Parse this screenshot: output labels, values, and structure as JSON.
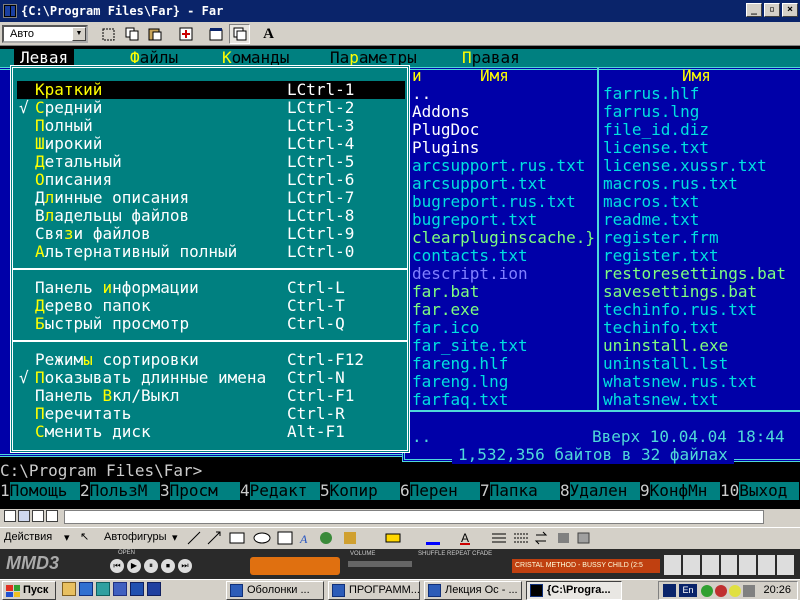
{
  "window": {
    "title": "{C:\\Program Files\\Far} - Far"
  },
  "toolbar": {
    "font_combo": "Авто",
    "font_letter": "A"
  },
  "menubar": [
    {
      "label": "Левая",
      "hotkey_index": 0,
      "selected": true
    },
    {
      "label": "Файлы",
      "hotkey_index": 0,
      "selected": false
    },
    {
      "label": "Команды",
      "hotkey_index": 0,
      "selected": false
    },
    {
      "label": "Параметры",
      "hotkey_index": 2,
      "selected": false
    },
    {
      "label": "Правая",
      "hotkey_index": 0,
      "selected": false
    }
  ],
  "dropdown": {
    "group1": [
      {
        "label": "Краткий",
        "key": "LCtrl-1",
        "checked": false,
        "selected": true
      },
      {
        "label": "Средний",
        "key": "LCtrl-2",
        "checked": true,
        "selected": false
      },
      {
        "label": "Полный",
        "key": "LCtrl-3",
        "checked": false,
        "selected": false
      },
      {
        "label": "Широкий",
        "key": "LCtrl-4",
        "checked": false,
        "selected": false
      },
      {
        "label": "Детальный",
        "key": "LCtrl-5",
        "checked": false,
        "selected": false
      },
      {
        "label": "Описания",
        "key": "LCtrl-6",
        "checked": false,
        "selected": false
      },
      {
        "label": "Длинные описания",
        "key": "LCtrl-7",
        "checked": false,
        "selected": false
      },
      {
        "label": "Владельцы файлов",
        "key": "LCtrl-8",
        "checked": false,
        "selected": false
      },
      {
        "label": "Связи файлов",
        "key": "LCtrl-9",
        "checked": false,
        "selected": false
      },
      {
        "label": "Альтернативный полный",
        "key": "LCtrl-0",
        "checked": false,
        "selected": false
      }
    ],
    "group2": [
      {
        "label": "Панель информации",
        "key": "Ctrl-L",
        "checked": false
      },
      {
        "label": "Дерево папок",
        "key": "Ctrl-T",
        "checked": false
      },
      {
        "label": "Быстрый просмотр",
        "key": "Ctrl-Q",
        "checked": false
      }
    ],
    "group3": [
      {
        "label": "Режимы сортировки",
        "key": "Ctrl-F12",
        "checked": false
      },
      {
        "label": "Показывать длинные имена",
        "key": "Ctrl-N",
        "checked": true
      },
      {
        "label": "Панель Вкл/Выкл",
        "key": "Ctrl-F1",
        "checked": false
      },
      {
        "label": "Перечитать",
        "key": "Ctrl-R",
        "checked": false
      },
      {
        "label": "Сменить диск",
        "key": "Alt-F1",
        "checked": false
      }
    ]
  },
  "left_panel_letters": [
    "и",
    ".",
    "A",
    "P",
    "P",
    "a",
    "a",
    "b",
    "b",
    "c",
    "c",
    "d",
    "f",
    "f",
    "f",
    "f",
    "f",
    "f",
    "f",
    "."
  ],
  "right_panel": {
    "col1_header": "Имя",
    "col2_header": "Имя",
    "col0_header_tail": "и",
    "col1": [
      {
        "name": "..",
        "kind": "up"
      },
      {
        "name": "Addons",
        "kind": "dir"
      },
      {
        "name": "PlugDoc",
        "kind": "dir"
      },
      {
        "name": "Plugins",
        "kind": "dir"
      },
      {
        "name": "arcsupport.rus.txt",
        "kind": "arc"
      },
      {
        "name": "arcsupport.txt",
        "kind": "arc"
      },
      {
        "name": "bugreport.rus.txt",
        "kind": "arc"
      },
      {
        "name": "bugreport.txt",
        "kind": "arc"
      },
      {
        "name": "clearpluginscache.}",
        "kind": "bat"
      },
      {
        "name": "contacts.txt",
        "kind": "arc"
      },
      {
        "name": "descript.ion",
        "kind": "sys"
      },
      {
        "name": "far.bat",
        "kind": "bat"
      },
      {
        "name": "far.exe",
        "kind": "bat"
      },
      {
        "name": "far.ico",
        "kind": "arc"
      },
      {
        "name": "far_site.txt",
        "kind": "arc"
      },
      {
        "name": "fareng.hlf",
        "kind": "arc"
      },
      {
        "name": "fareng.lng",
        "kind": "arc"
      },
      {
        "name": "farfaq.txt",
        "kind": "arc"
      }
    ],
    "col2": [
      {
        "name": "farrus.hlf",
        "kind": "arc"
      },
      {
        "name": "farrus.lng",
        "kind": "arc"
      },
      {
        "name": "file_id.diz",
        "kind": "arc"
      },
      {
        "name": "license.txt",
        "kind": "arc"
      },
      {
        "name": "license.xussr.txt",
        "kind": "arc"
      },
      {
        "name": "macros.rus.txt",
        "kind": "arc"
      },
      {
        "name": "macros.txt",
        "kind": "arc"
      },
      {
        "name": "readme.txt",
        "kind": "arc"
      },
      {
        "name": "register.frm",
        "kind": "arc"
      },
      {
        "name": "register.txt",
        "kind": "arc"
      },
      {
        "name": "restoresettings.bat",
        "kind": "bat"
      },
      {
        "name": "savesettings.bat",
        "kind": "bat"
      },
      {
        "name": "techinfo.rus.txt",
        "kind": "arc"
      },
      {
        "name": "techinfo.txt",
        "kind": "arc"
      },
      {
        "name": "uninstall.exe",
        "kind": "bat"
      },
      {
        "name": "uninstall.lst",
        "kind": "arc"
      },
      {
        "name": "whatsnew.rus.txt",
        "kind": "arc"
      },
      {
        "name": "whatsnew.txt",
        "kind": "arc"
      }
    ],
    "status_up": "..",
    "status_info": "Вверх 10.04.04 18:44",
    "summary": "1,532,356 байтов в 32 файлах"
  },
  "cmdline": "C:\\Program Files\\Far>",
  "keybar": [
    {
      "num": "1",
      "label": "Помощь"
    },
    {
      "num": "2",
      "label": "ПользМ"
    },
    {
      "num": "3",
      "label": "Просм"
    },
    {
      "num": "4",
      "label": "Редакт"
    },
    {
      "num": "5",
      "label": "Копир"
    },
    {
      "num": "6",
      "label": "Перен"
    },
    {
      "num": "7",
      "label": "Папка"
    },
    {
      "num": "8",
      "label": "Удален"
    },
    {
      "num": "9",
      "label": "КонфМн"
    },
    {
      "num": "10",
      "label": "Выход"
    }
  ],
  "drawbar": {
    "actions": "Действия",
    "autoshapes": "Автофигуры"
  },
  "winamp": {
    "logo": "MMD3",
    "open": "OPEN",
    "volume": "VOLUME",
    "modes": "SHUFFLE REPEAT CFADE",
    "track": "CRISTAL METHOD - BUSSY CHILD (2:5"
  },
  "taskbar": {
    "start": "Пуск",
    "tasks": [
      {
        "label": "Оболонки ...",
        "active": false
      },
      {
        "label": "ПРОГРАММ...",
        "active": false
      },
      {
        "label": "Лекция Ос - ...",
        "active": false
      },
      {
        "label": "{C:\\Progra...",
        "active": true
      }
    ],
    "lang": "En",
    "clock": "20:26"
  }
}
